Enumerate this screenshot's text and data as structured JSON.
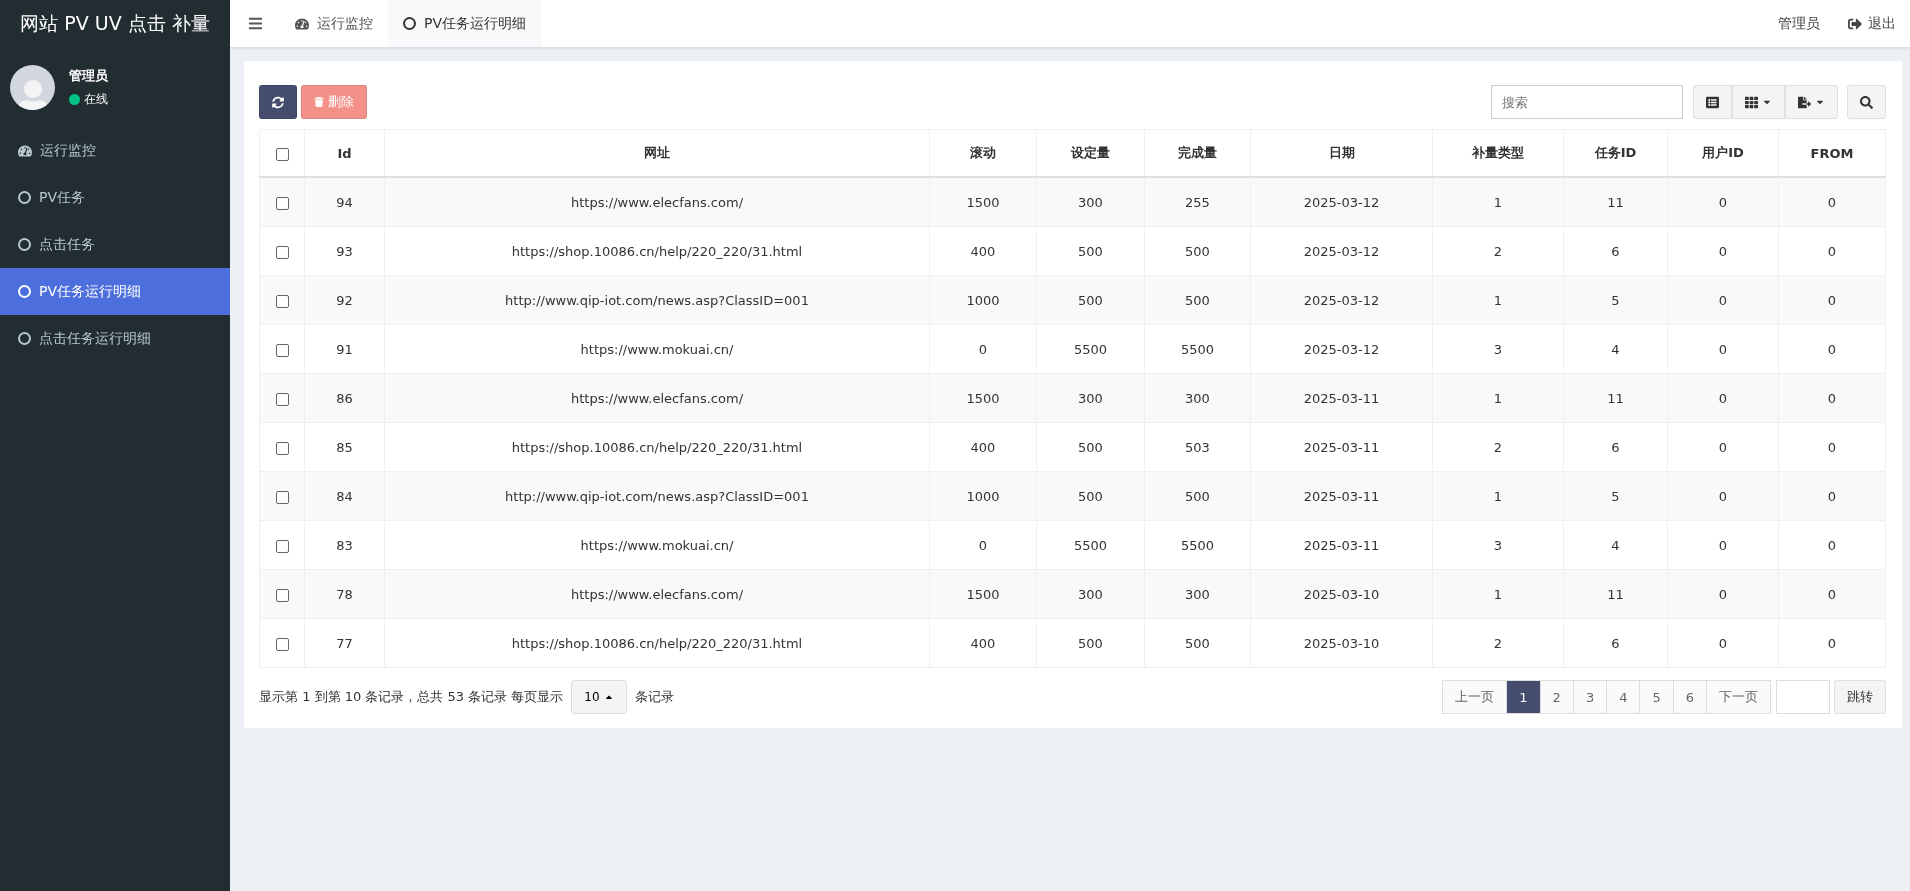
{
  "sidebar": {
    "title": "网站 PV UV 点击 补量",
    "user": {
      "name": "管理员",
      "status": "在线",
      "online": true
    },
    "items": [
      {
        "label": "运行监控",
        "kind": "dashboard",
        "selected": false
      },
      {
        "label": "PV任务",
        "kind": "task",
        "selected": false
      },
      {
        "label": "点击任务",
        "kind": "task",
        "selected": false
      },
      {
        "label": "PV任务运行明细",
        "kind": "task",
        "selected": true
      },
      {
        "label": "点击任务运行明细",
        "kind": "task",
        "selected": false
      }
    ]
  },
  "topbar": {
    "tabs": [
      {
        "label": "运行监控",
        "kind": "dashboard",
        "selected": false
      },
      {
        "label": "PV任务运行明细",
        "kind": "task",
        "selected": true
      }
    ],
    "user": "管理员",
    "logout": "退出"
  },
  "toolbar": {
    "delete": "删除",
    "search": {
      "placeholder": "搜索"
    }
  },
  "table": {
    "all_checked": false,
    "columns": [
      "Id",
      "网址",
      "滚动",
      "设定量",
      "完成量",
      "日期",
      "补量类型",
      "任务ID",
      "用户ID",
      "FROM"
    ],
    "rows": [
      {
        "checked": false,
        "cells": [
          "94",
          "https://www.elecfans.com/",
          "1500",
          "300",
          "255",
          "2025-03-12",
          "1",
          "11",
          "0",
          "0"
        ]
      },
      {
        "checked": false,
        "cells": [
          "93",
          "https://shop.10086.cn/help/220_220/31.html",
          "400",
          "500",
          "500",
          "2025-03-12",
          "2",
          "6",
          "0",
          "0"
        ]
      },
      {
        "checked": false,
        "cells": [
          "92",
          "http://www.qip-iot.com/news.asp?ClassID=001",
          "1000",
          "500",
          "500",
          "2025-03-12",
          "1",
          "5",
          "0",
          "0"
        ]
      },
      {
        "checked": false,
        "cells": [
          "91",
          "https://www.mokuai.cn/",
          "0",
          "5500",
          "5500",
          "2025-03-12",
          "3",
          "4",
          "0",
          "0"
        ]
      },
      {
        "checked": false,
        "cells": [
          "86",
          "https://www.elecfans.com/",
          "1500",
          "300",
          "300",
          "2025-03-11",
          "1",
          "11",
          "0",
          "0"
        ]
      },
      {
        "checked": false,
        "cells": [
          "85",
          "https://shop.10086.cn/help/220_220/31.html",
          "400",
          "500",
          "503",
          "2025-03-11",
          "2",
          "6",
          "0",
          "0"
        ]
      },
      {
        "checked": false,
        "cells": [
          "84",
          "http://www.qip-iot.com/news.asp?ClassID=001",
          "1000",
          "500",
          "500",
          "2025-03-11",
          "1",
          "5",
          "0",
          "0"
        ]
      },
      {
        "checked": false,
        "cells": [
          "83",
          "https://www.mokuai.cn/",
          "0",
          "5500",
          "5500",
          "2025-03-11",
          "3",
          "4",
          "0",
          "0"
        ]
      },
      {
        "checked": false,
        "cells": [
          "78",
          "https://www.elecfans.com/",
          "1500",
          "300",
          "300",
          "2025-03-10",
          "1",
          "11",
          "0",
          "0"
        ]
      },
      {
        "checked": false,
        "cells": [
          "77",
          "https://shop.10086.cn/help/220_220/31.html",
          "400",
          "500",
          "500",
          "2025-03-10",
          "2",
          "6",
          "0",
          "0"
        ]
      }
    ]
  },
  "footer": {
    "summary": "显示第 1 到第 10 条记录，总共 53 条记录 每页显示",
    "page_size": "10",
    "suffix": "条记录",
    "pages": [
      {
        "label": "上一页",
        "selected": false
      },
      {
        "label": "1",
        "selected": true
      },
      {
        "label": "2",
        "selected": false
      },
      {
        "label": "3",
        "selected": false
      },
      {
        "label": "4",
        "selected": false
      },
      {
        "label": "5",
        "selected": false
      },
      {
        "label": "6",
        "selected": false
      },
      {
        "label": "下一页",
        "selected": false
      }
    ],
    "jump": "跳转"
  }
}
